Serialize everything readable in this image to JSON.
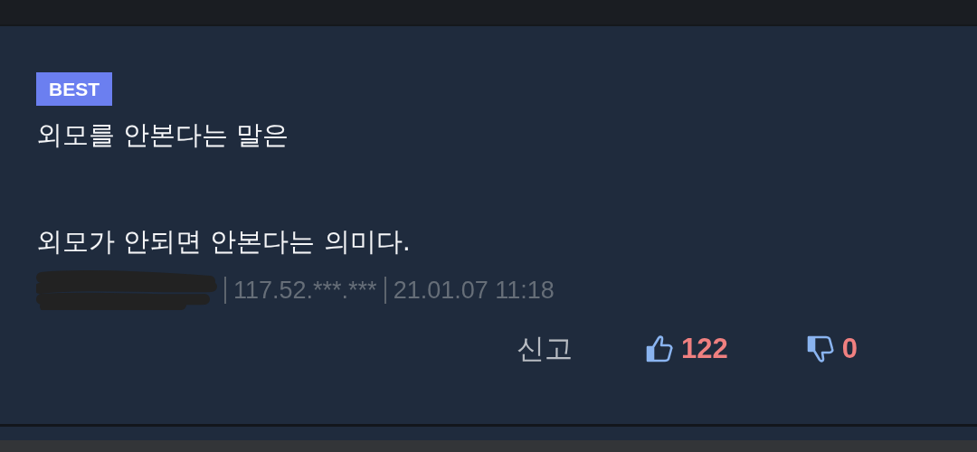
{
  "comment": {
    "badge": "BEST",
    "paragraphs": [
      "외모를 안본다는 말은",
      "외모가 안되면 안본다는 의미다."
    ],
    "author": {
      "redacted": true
    },
    "meta": [
      "117.52.***.***",
      "21.01.07 11:18"
    ],
    "report": "신고",
    "likes": "122",
    "dislikes": "0"
  }
}
